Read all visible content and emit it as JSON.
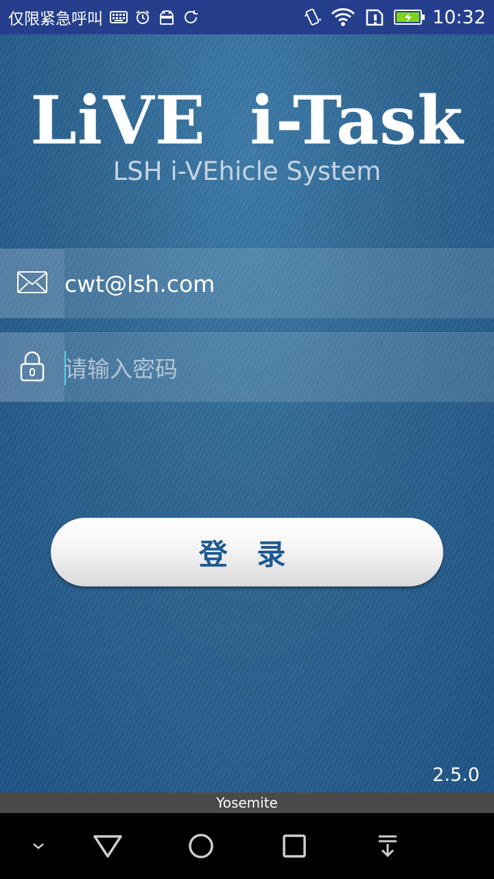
{
  "status_bar": {
    "carrier": "仅限紧急呼叫",
    "time": "10:32",
    "left_icons": [
      "keyboard-icon",
      "alarm-icon",
      "android-icon",
      "sync-icon"
    ],
    "right_icons": [
      "vibrate-icon",
      "wifi-icon",
      "sim-alert-icon",
      "battery-charging-icon"
    ],
    "battery_color": "#7ed321"
  },
  "app": {
    "title": "LiVE  i-Task",
    "subtitle": "LSH i-VEhicle System",
    "email": {
      "icon": "mail-icon",
      "value": "cwt@lsh.com"
    },
    "password": {
      "icon": "lock-icon",
      "placeholder": "请输入密码"
    },
    "login_button": "登 录",
    "version": "2.5.0"
  },
  "wifi_banner": "Yosemite",
  "nav_bar": {
    "buttons": [
      "collapse-icon",
      "back-icon",
      "home-icon",
      "recents-icon",
      "notification-pull-icon"
    ]
  },
  "colors": {
    "status_bar_bg": "#253f8c",
    "background": "#2f6590",
    "login_text": "#1d5a93",
    "caret": "#5fd0e8"
  }
}
